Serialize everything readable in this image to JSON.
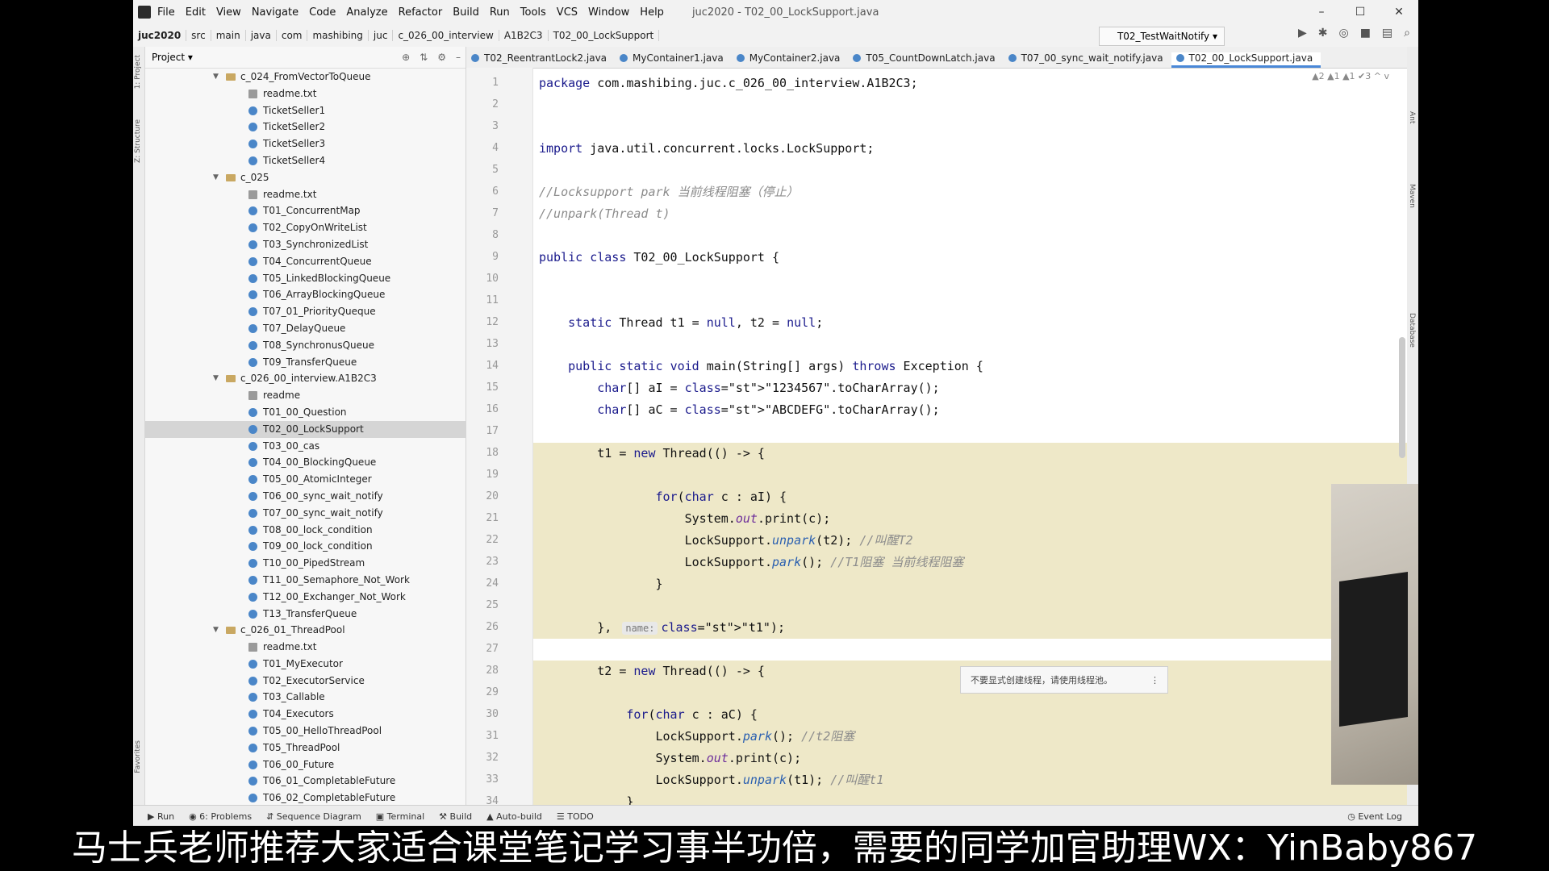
{
  "window": {
    "title": "juc2020 - T02_00_LockSupport.java",
    "menu": [
      "File",
      "Edit",
      "View",
      "Navigate",
      "Code",
      "Analyze",
      "Refactor",
      "Build",
      "Run",
      "Tools",
      "VCS",
      "Window",
      "Help"
    ]
  },
  "breadcrumbs": [
    "juc2020",
    "src",
    "main",
    "java",
    "com",
    "mashibing",
    "juc",
    "c_026_00_interview",
    "A1B2C3",
    "T02_00_LockSupport"
  ],
  "run_config": "T02_TestWaitNotify",
  "project_panel": {
    "title": "Project",
    "items": [
      {
        "label": "c_024_FromVectorToQueue",
        "type": "folder",
        "depth": 0
      },
      {
        "label": "readme.txt",
        "type": "txt",
        "depth": 1
      },
      {
        "label": "TicketSeller1",
        "type": "class",
        "depth": 1
      },
      {
        "label": "TicketSeller2",
        "type": "class",
        "depth": 1
      },
      {
        "label": "TicketSeller3",
        "type": "class",
        "depth": 1
      },
      {
        "label": "TicketSeller4",
        "type": "class",
        "depth": 1
      },
      {
        "label": "c_025",
        "type": "folder",
        "depth": 0
      },
      {
        "label": "readme.txt",
        "type": "txt",
        "depth": 1
      },
      {
        "label": "T01_ConcurrentMap",
        "type": "class",
        "depth": 1
      },
      {
        "label": "T02_CopyOnWriteList",
        "type": "class",
        "depth": 1
      },
      {
        "label": "T03_SynchronizedList",
        "type": "class",
        "depth": 1
      },
      {
        "label": "T04_ConcurrentQueue",
        "type": "class",
        "depth": 1
      },
      {
        "label": "T05_LinkedBlockingQueue",
        "type": "class",
        "depth": 1
      },
      {
        "label": "T06_ArrayBlockingQueue",
        "type": "class",
        "depth": 1
      },
      {
        "label": "T07_01_PriorityQueque",
        "type": "class",
        "depth": 1
      },
      {
        "label": "T07_DelayQueue",
        "type": "class",
        "depth": 1
      },
      {
        "label": "T08_SynchronusQueue",
        "type": "class",
        "depth": 1
      },
      {
        "label": "T09_TransferQueue",
        "type": "class",
        "depth": 1
      },
      {
        "label": "c_026_00_interview.A1B2C3",
        "type": "folder",
        "depth": 0
      },
      {
        "label": "readme",
        "type": "txt",
        "depth": 1
      },
      {
        "label": "T01_00_Question",
        "type": "class",
        "depth": 1
      },
      {
        "label": "T02_00_LockSupport",
        "type": "class",
        "depth": 1,
        "selected": true
      },
      {
        "label": "T03_00_cas",
        "type": "class",
        "depth": 1
      },
      {
        "label": "T04_00_BlockingQueue",
        "type": "class",
        "depth": 1
      },
      {
        "label": "T05_00_AtomicInteger",
        "type": "class",
        "depth": 1
      },
      {
        "label": "T06_00_sync_wait_notify",
        "type": "class",
        "depth": 1
      },
      {
        "label": "T07_00_sync_wait_notify",
        "type": "class",
        "depth": 1
      },
      {
        "label": "T08_00_lock_condition",
        "type": "class",
        "depth": 1
      },
      {
        "label": "T09_00_lock_condition",
        "type": "class",
        "depth": 1
      },
      {
        "label": "T10_00_PipedStream",
        "type": "class",
        "depth": 1
      },
      {
        "label": "T11_00_Semaphore_Not_Work",
        "type": "class",
        "depth": 1
      },
      {
        "label": "T12_00_Exchanger_Not_Work",
        "type": "class",
        "depth": 1
      },
      {
        "label": "T13_TransferQueue",
        "type": "class",
        "depth": 1
      },
      {
        "label": "c_026_01_ThreadPool",
        "type": "folder",
        "depth": 0
      },
      {
        "label": "readme.txt",
        "type": "txt",
        "depth": 1
      },
      {
        "label": "T01_MyExecutor",
        "type": "class",
        "depth": 1
      },
      {
        "label": "T02_ExecutorService",
        "type": "class",
        "depth": 1
      },
      {
        "label": "T03_Callable",
        "type": "class",
        "depth": 1
      },
      {
        "label": "T04_Executors",
        "type": "class",
        "depth": 1
      },
      {
        "label": "T05_00_HelloThreadPool",
        "type": "class",
        "depth": 1
      },
      {
        "label": "T05_ThreadPool",
        "type": "class",
        "depth": 1
      },
      {
        "label": "T06_00_Future",
        "type": "class",
        "depth": 1
      },
      {
        "label": "T06_01_CompletableFuture",
        "type": "class",
        "depth": 1
      },
      {
        "label": "T06_02_CompletableFuture",
        "type": "class",
        "depth": 1
      }
    ]
  },
  "editor_tabs": [
    {
      "label": "T02_ReentrantLock2.java",
      "active": false
    },
    {
      "label": "MyContainer1.java",
      "active": false
    },
    {
      "label": "MyContainer2.java",
      "active": false
    },
    {
      "label": "T05_CountDownLatch.java",
      "active": false
    },
    {
      "label": "T07_00_sync_wait_notify.java",
      "active": false
    },
    {
      "label": "T02_00_LockSupport.java",
      "active": true
    }
  ],
  "inspections": "▲2 ▲1 ▲1 ✔3 ^ v",
  "code_lines": [
    {
      "n": "1",
      "text": "package com.mashibing.juc.c_026_00_interview.A1B2C3;",
      "hl": false
    },
    {
      "n": "2",
      "text": "",
      "hl": false
    },
    {
      "n": "3",
      "text": "",
      "hl": false
    },
    {
      "n": "4",
      "text": "import java.util.concurrent.locks.LockSupport;",
      "hl": false
    },
    {
      "n": "5",
      "text": "",
      "hl": false
    },
    {
      "n": "6",
      "text": "//Locksupport park 当前线程阻塞（停止）",
      "hl": false
    },
    {
      "n": "7",
      "text": "//unpark(Thread t)",
      "hl": false
    },
    {
      "n": "8",
      "text": "",
      "hl": false
    },
    {
      "n": "9",
      "text": "public class T02_00_LockSupport {",
      "hl": false
    },
    {
      "n": "10",
      "text": "",
      "hl": false
    },
    {
      "n": "11",
      "text": "",
      "hl": false
    },
    {
      "n": "12",
      "text": "    static Thread t1 = null, t2 = null;",
      "hl": false
    },
    {
      "n": "13",
      "text": "",
      "hl": false
    },
    {
      "n": "14",
      "text": "    public static void main(String[] args) throws Exception {",
      "hl": false
    },
    {
      "n": "15",
      "text": "        char[] aI = \"1234567\".toCharArray();",
      "hl": false
    },
    {
      "n": "16",
      "text": "        char[] aC = \"ABCDEFG\".toCharArray();",
      "hl": false
    },
    {
      "n": "17",
      "text": "",
      "hl": false
    },
    {
      "n": "18",
      "text": "        t1 = new Thread(() -> {",
      "hl": true
    },
    {
      "n": "19",
      "text": "",
      "hl": true
    },
    {
      "n": "20",
      "text": "                for(char c : aI) {",
      "hl": true
    },
    {
      "n": "21",
      "text": "                    System.out.print(c);",
      "hl": true
    },
    {
      "n": "22",
      "text": "                    LockSupport.unpark(t2); //叫醒T2",
      "hl": true
    },
    {
      "n": "23",
      "text": "                    LockSupport.park(); //T1阻塞 当前线程阻塞",
      "hl": true
    },
    {
      "n": "24",
      "text": "                }",
      "hl": true
    },
    {
      "n": "25",
      "text": "",
      "hl": true
    },
    {
      "n": "26",
      "text": "        }, name: \"t1\");",
      "hl": true
    },
    {
      "n": "27",
      "text": "",
      "hl": false
    },
    {
      "n": "28",
      "text": "        t2 = new Thread(() -> {",
      "hl": true
    },
    {
      "n": "29",
      "text": "",
      "hl": true
    },
    {
      "n": "30",
      "text": "            for(char c : aC) {",
      "hl": true
    },
    {
      "n": "31",
      "text": "                LockSupport.park(); //t2阻塞",
      "hl": true
    },
    {
      "n": "32",
      "text": "                System.out.print(c);",
      "hl": true
    },
    {
      "n": "33",
      "text": "                LockSupport.unpark(t1); //叫醒t1",
      "hl": true
    },
    {
      "n": "34",
      "text": "            }",
      "hl": true
    }
  ],
  "tooltip": "不要显式创建线程，请使用线程池。",
  "bottom_tools": [
    "Run",
    "6: Problems",
    "Sequence Diagram",
    "Terminal",
    "Build",
    "Auto-build",
    "TODO"
  ],
  "event_log": "Event Log",
  "side_labels": {
    "left": [
      "1: Project",
      "Z: Structure",
      "Favorites"
    ],
    "right": [
      "Ant",
      "Maven",
      "Database"
    ]
  },
  "caption": "马士兵老师推荐大家适合课堂笔记学习事半功倍，需要的同学加官助理WX：YinBaby867"
}
